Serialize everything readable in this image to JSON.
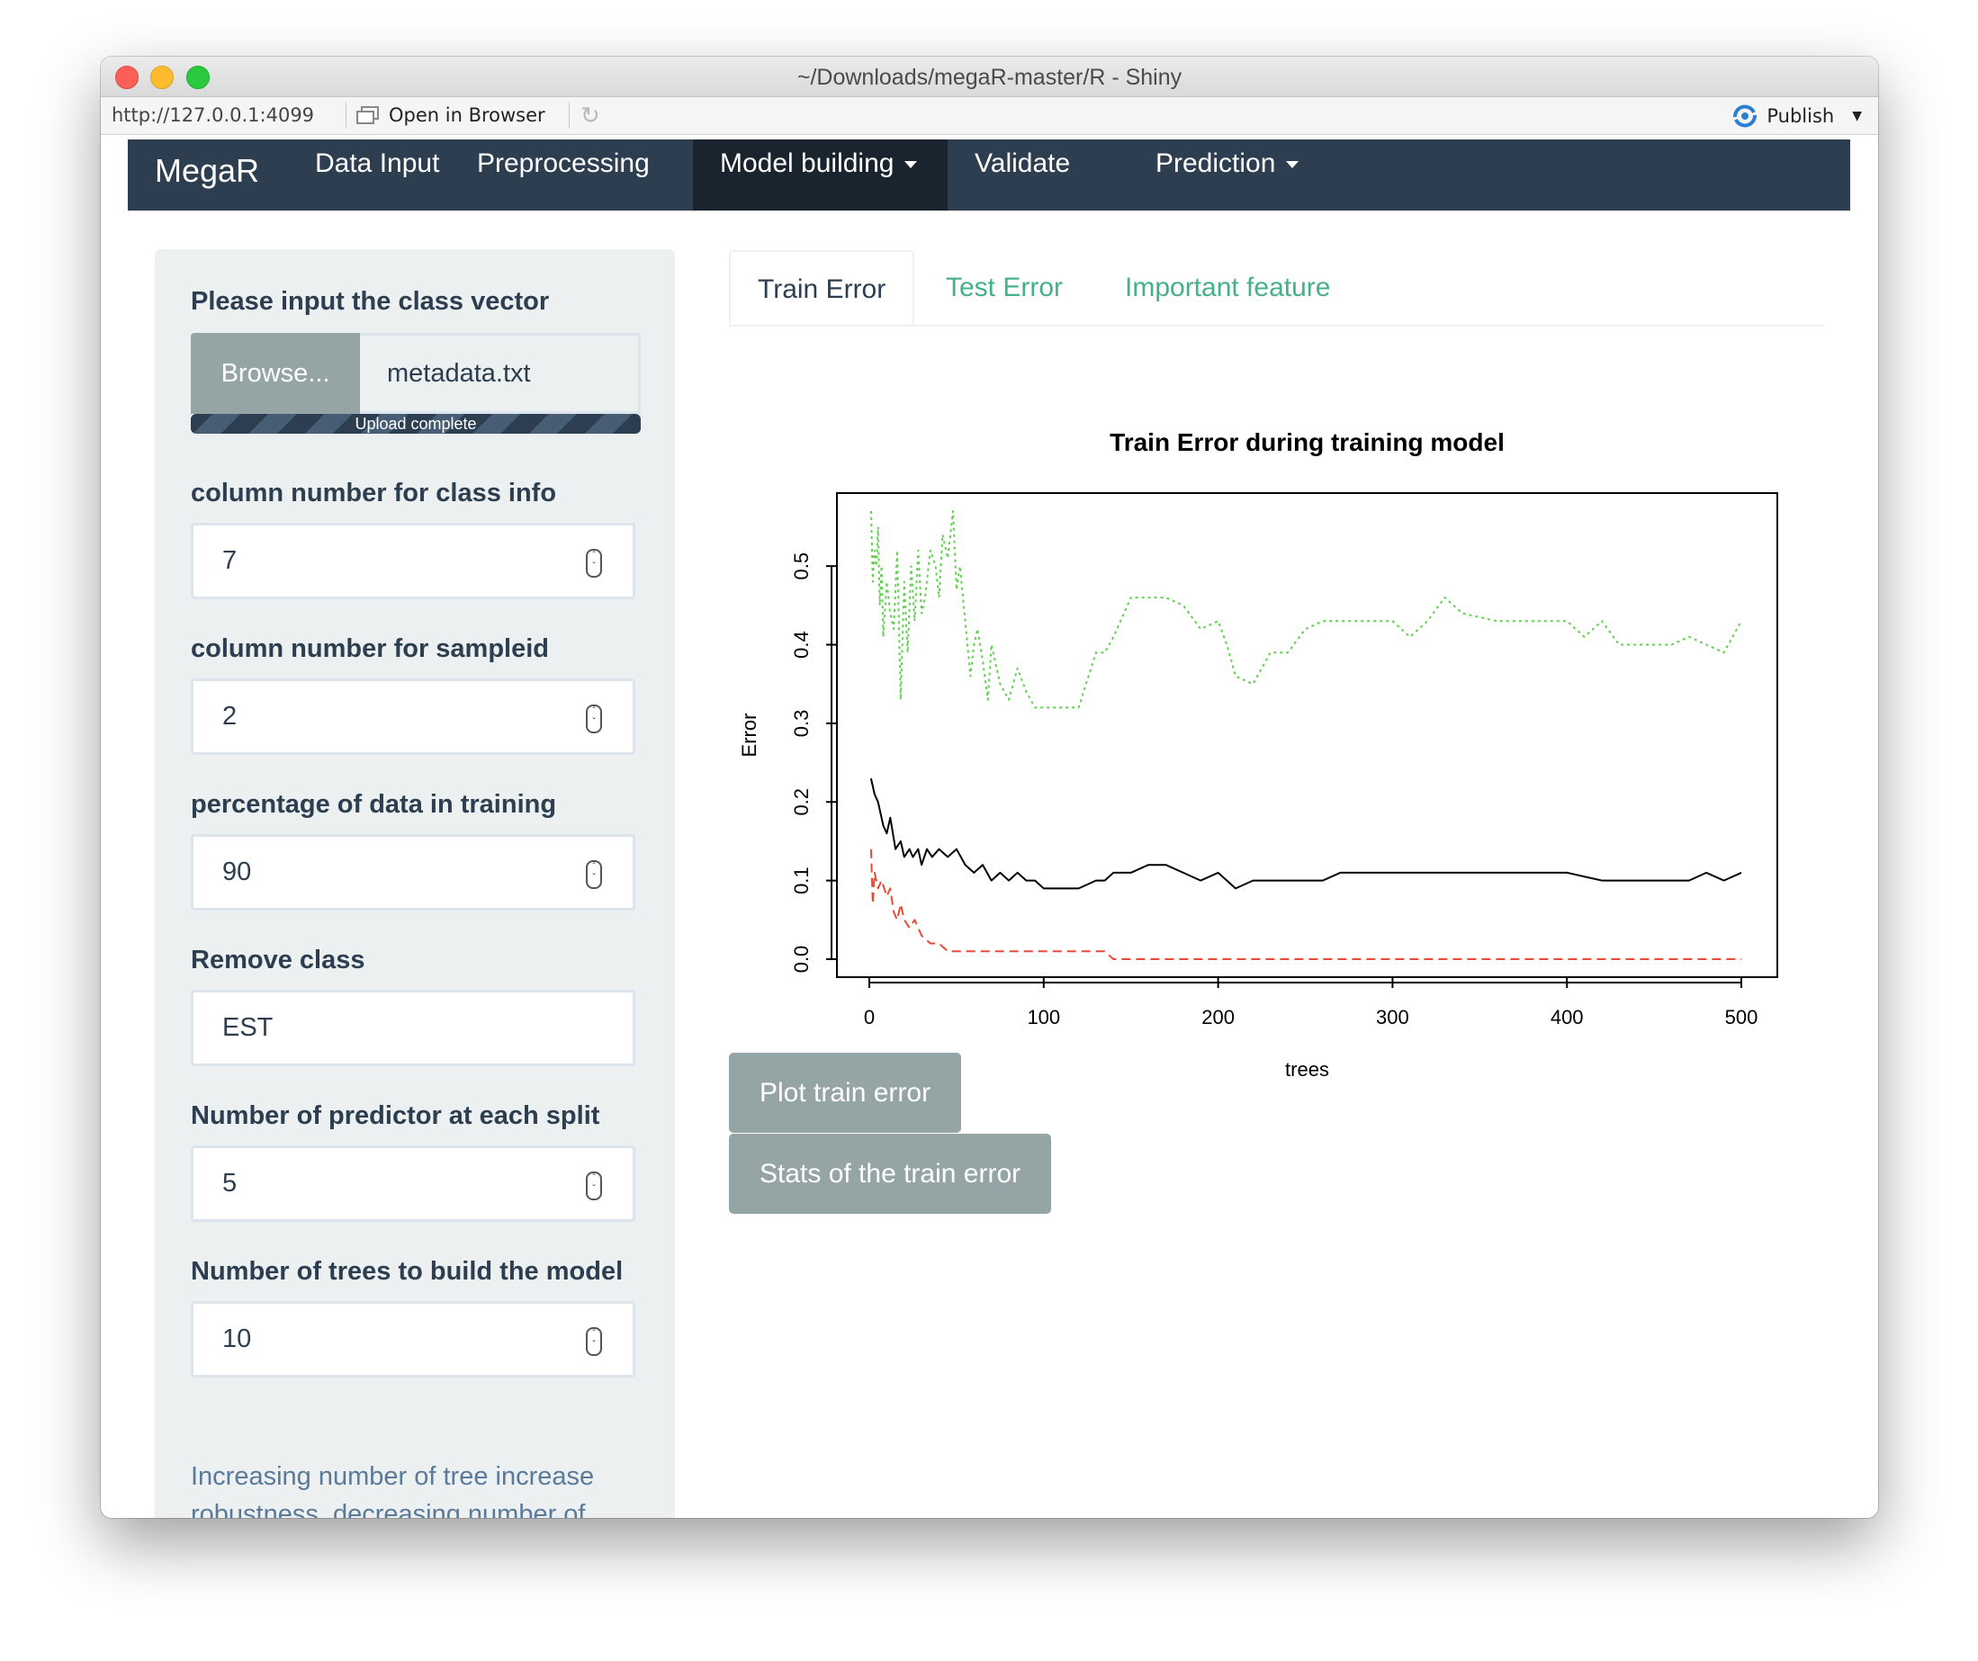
{
  "window": {
    "title": "~/Downloads/megaR-master/R - Shiny",
    "url": "http://127.0.0.1:4099",
    "open_in_browser": "Open in Browser",
    "publish": "Publish"
  },
  "navbar": {
    "brand": "MegaR",
    "items": [
      {
        "label": "Data Input"
      },
      {
        "label": "Preprocessing"
      },
      {
        "label": "Model building"
      },
      {
        "label": "Validate"
      },
      {
        "label": "Prediction"
      }
    ]
  },
  "sidebar": {
    "class_vector": {
      "label": "Please input the class vector",
      "browse_label": "Browse...",
      "file_name": "metadata.txt",
      "progress_text": "Upload complete",
      "progress": 1.0
    },
    "class_info": {
      "label": "column number for class info",
      "value": "7"
    },
    "sampleid": {
      "label": "column number for sampleid",
      "value": "2"
    },
    "training_pct": {
      "label": "percentage of data in training",
      "value": "90"
    },
    "remove_class": {
      "label": "Remove class",
      "value": "EST"
    },
    "mtry": {
      "label": "Number of predictor at each split",
      "value": "5"
    },
    "ntree": {
      "label": "Number of trees to build the model",
      "value": "10"
    },
    "help_text": "Increasing number of tree increase robustness, decreasing number of mtry increase roustness"
  },
  "tabs": [
    {
      "label": "Train Error"
    },
    {
      "label": "Test Error"
    },
    {
      "label": "Important feature"
    }
  ],
  "buttons": {
    "plot_train_error": "Plot train error",
    "stats_train_error": "Stats of the train error"
  },
  "chart_data": {
    "type": "line",
    "title": "Train Error during training model",
    "xlabel": "trees",
    "ylabel": "Error",
    "xlim": [
      0,
      500
    ],
    "ylim": [
      0,
      0.57
    ],
    "xticks": [
      "0",
      "100",
      "200",
      "300",
      "400",
      "500"
    ],
    "yticks": [
      "0.0",
      "0.1",
      "0.2",
      "0.3",
      "0.4",
      "0.5"
    ],
    "grid": false,
    "legend": "none",
    "series": [
      {
        "color": "#000000",
        "style": "solid",
        "x": [
          1,
          3,
          5,
          8,
          10,
          12,
          15,
          18,
          20,
          23,
          25,
          28,
          30,
          33,
          36,
          40,
          45,
          50,
          55,
          60,
          65,
          70,
          75,
          80,
          85,
          90,
          95,
          100,
          110,
          120,
          130,
          135,
          140,
          150,
          160,
          170,
          180,
          190,
          200,
          205,
          210,
          220,
          230,
          250,
          260,
          270,
          280,
          300,
          320,
          330,
          350,
          380,
          400,
          420,
          440,
          460,
          470,
          480,
          490,
          500
        ],
        "y": [
          0.23,
          0.21,
          0.2,
          0.17,
          0.16,
          0.18,
          0.14,
          0.15,
          0.13,
          0.14,
          0.13,
          0.14,
          0.12,
          0.14,
          0.13,
          0.14,
          0.13,
          0.14,
          0.12,
          0.11,
          0.12,
          0.1,
          0.11,
          0.1,
          0.11,
          0.1,
          0.1,
          0.09,
          0.09,
          0.09,
          0.1,
          0.1,
          0.11,
          0.11,
          0.12,
          0.12,
          0.11,
          0.1,
          0.11,
          0.1,
          0.09,
          0.1,
          0.1,
          0.1,
          0.1,
          0.11,
          0.11,
          0.11,
          0.11,
          0.11,
          0.11,
          0.11,
          0.11,
          0.1,
          0.1,
          0.1,
          0.1,
          0.11,
          0.1,
          0.11
        ]
      },
      {
        "color": "#e64b35",
        "style": "dashed",
        "x": [
          1,
          2,
          3,
          5,
          7,
          10,
          12,
          14,
          16,
          18,
          20,
          23,
          26,
          30,
          35,
          40,
          45,
          50,
          60,
          70,
          80,
          90,
          100,
          110,
          120,
          130,
          135,
          140,
          145,
          150,
          200,
          250,
          300,
          350,
          400,
          450,
          500
        ],
        "y": [
          0.14,
          0.07,
          0.11,
          0.09,
          0.1,
          0.08,
          0.09,
          0.06,
          0.05,
          0.07,
          0.05,
          0.04,
          0.05,
          0.03,
          0.02,
          0.02,
          0.01,
          0.01,
          0.01,
          0.01,
          0.01,
          0.01,
          0.01,
          0.01,
          0.01,
          0.01,
          0.01,
          0.0,
          0.0,
          0.0,
          0.0,
          0.0,
          0.0,
          0.0,
          0.0,
          0.0,
          0.0
        ]
      },
      {
        "color": "#61d04f",
        "style": "dotted",
        "x": [
          1,
          2,
          3,
          4,
          5,
          6,
          7,
          8,
          10,
          12,
          14,
          16,
          18,
          20,
          22,
          24,
          26,
          28,
          30,
          32,
          35,
          38,
          40,
          42,
          45,
          48,
          50,
          52,
          55,
          58,
          60,
          62,
          65,
          68,
          70,
          75,
          80,
          85,
          90,
          95,
          100,
          110,
          120,
          130,
          135,
          140,
          150,
          160,
          170,
          180,
          190,
          200,
          205,
          210,
          220,
          230,
          240,
          250,
          260,
          270,
          280,
          300,
          310,
          320,
          330,
          340,
          360,
          380,
          390,
          400,
          410,
          420,
          430,
          440,
          450,
          460,
          470,
          480,
          490,
          500
        ],
        "y": [
          0.57,
          0.48,
          0.52,
          0.5,
          0.55,
          0.45,
          0.5,
          0.41,
          0.48,
          0.44,
          0.42,
          0.52,
          0.33,
          0.48,
          0.39,
          0.5,
          0.43,
          0.52,
          0.44,
          0.46,
          0.52,
          0.5,
          0.46,
          0.54,
          0.51,
          0.57,
          0.47,
          0.5,
          0.43,
          0.36,
          0.4,
          0.42,
          0.38,
          0.33,
          0.4,
          0.35,
          0.33,
          0.37,
          0.34,
          0.32,
          0.32,
          0.32,
          0.32,
          0.39,
          0.39,
          0.41,
          0.46,
          0.46,
          0.46,
          0.45,
          0.42,
          0.43,
          0.4,
          0.36,
          0.35,
          0.39,
          0.39,
          0.42,
          0.43,
          0.43,
          0.43,
          0.43,
          0.41,
          0.43,
          0.46,
          0.44,
          0.43,
          0.43,
          0.43,
          0.43,
          0.41,
          0.43,
          0.4,
          0.4,
          0.4,
          0.4,
          0.41,
          0.4,
          0.39,
          0.43
        ]
      }
    ]
  }
}
